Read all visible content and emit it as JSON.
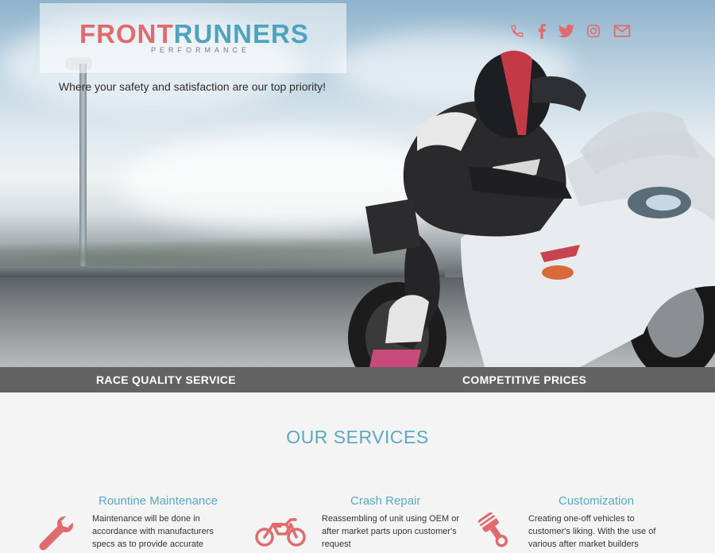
{
  "brand": {
    "name_part1": "FRONT",
    "name_part2": "RUNNERS",
    "subtitle": "PERFORMANCE",
    "tagline": "Where your safety and satisfaction are our top priority!"
  },
  "social": [
    {
      "icon": "phone-icon"
    },
    {
      "icon": "facebook-icon"
    },
    {
      "icon": "twitter-icon"
    },
    {
      "icon": "instagram-icon"
    },
    {
      "icon": "email-icon"
    }
  ],
  "band": {
    "left": "RACE QUALITY SERVICE",
    "right": "COMPETITIVE PRICES"
  },
  "services": {
    "title": "OUR SERVICES",
    "items": [
      {
        "title": "Rountine Maintenance",
        "text": "Maintenance will be done in accordance with manufacturers specs as to provide accurate",
        "icon": "wrench-icon"
      },
      {
        "title": "Crash Repair",
        "text": "Reassembling of unit using OEM or after market parts upon customer's request",
        "icon": "motorcycle-icon"
      },
      {
        "title": "Customization",
        "text": "Creating one-off vehicles to customer's liking. With the use of various after market builders",
        "icon": "piston-icon"
      }
    ]
  },
  "colors": {
    "accent_red": "#e06b6e",
    "accent_blue": "#4fa3bd",
    "band": "#636363"
  }
}
